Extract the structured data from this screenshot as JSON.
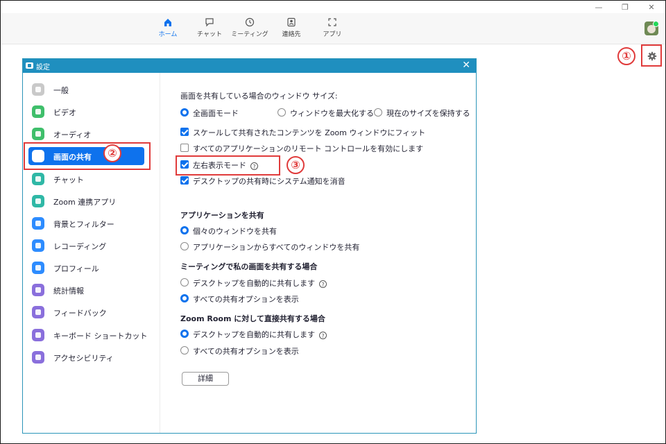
{
  "window_controls": {
    "minimize": "—",
    "restore": "❐",
    "close": "✕"
  },
  "top_nav": {
    "tabs": [
      {
        "label": "ホーム",
        "icon": "home-icon",
        "active": true
      },
      {
        "label": "チャット",
        "icon": "chat-icon",
        "active": false
      },
      {
        "label": "ミーティング",
        "icon": "clock-icon",
        "active": false
      },
      {
        "label": "連絡先",
        "icon": "contacts-icon",
        "active": false
      },
      {
        "label": "アプリ",
        "icon": "apps-icon",
        "active": false
      }
    ],
    "accent_color": "#0e72ed"
  },
  "callouts": {
    "one": "①",
    "two": "②",
    "three": "③"
  },
  "dialog": {
    "title": "設定",
    "close": "✕",
    "title_bar_color": "#1f8fbf"
  },
  "sidebar": {
    "items": [
      {
        "label": "一般",
        "icon": "gear-icon",
        "color": "#c9c9c9"
      },
      {
        "label": "ビデオ",
        "icon": "video-icon",
        "color": "#3fbf6b"
      },
      {
        "label": "オーディオ",
        "icon": "headphones-icon",
        "color": "#3fbf6b"
      },
      {
        "label": "画面の共有",
        "icon": "share-screen-icon",
        "color": "#ffffff",
        "selected": true
      },
      {
        "label": "チャット",
        "icon": "chat-icon",
        "color": "#2fb8a6"
      },
      {
        "label": "Zoom 連携アプリ",
        "icon": "apps-icon",
        "color": "#2fb8a6"
      },
      {
        "label": "背景とフィルター",
        "icon": "background-icon",
        "color": "#2d8cff"
      },
      {
        "label": "レコーディング",
        "icon": "record-icon",
        "color": "#2d8cff"
      },
      {
        "label": "プロフィール",
        "icon": "profile-icon",
        "color": "#2d8cff"
      },
      {
        "label": "統計情報",
        "icon": "statistics-icon",
        "color": "#8a6fdc"
      },
      {
        "label": "フィードバック",
        "icon": "feedback-icon",
        "color": "#8a6fdc"
      },
      {
        "label": "キーボード ショートカット",
        "icon": "keyboard-icon",
        "color": "#8a6fdc"
      },
      {
        "label": "アクセシビリティ",
        "icon": "accessibility-icon",
        "color": "#8a6fdc"
      }
    ]
  },
  "content": {
    "window_size_title": "画面を共有している場合のウィンドウ サイズ:",
    "window_size_options": [
      {
        "label": "全画面モード",
        "selected": true
      },
      {
        "label": "ウィンドウを最大化する",
        "selected": false
      },
      {
        "label": "現在のサイズを保持する",
        "selected": false
      }
    ],
    "checkboxes": [
      {
        "label": "スケールして共有されたコンテンツを Zoom ウィンドウにフィット",
        "checked": true
      },
      {
        "label": "すべてのアプリケーションのリモート コントロールを有効にします",
        "checked": false
      },
      {
        "label": "左右表示モード",
        "checked": true,
        "help": "?"
      },
      {
        "label": "デスクトップの共有時にシステム通知を消音",
        "checked": true
      }
    ],
    "app_share_title": "アプリケーションを共有",
    "app_share_options": [
      {
        "label": "個々のウィンドウを共有",
        "selected": true
      },
      {
        "label": "アプリケーションからすべてのウィンドウを共有",
        "selected": false
      }
    ],
    "meeting_share_title": "ミーティングで私の画面を共有する場合",
    "meeting_share_options": [
      {
        "label": "デスクトップを自動的に共有します",
        "selected": false,
        "help": "?"
      },
      {
        "label": "すべての共有オプションを表示",
        "selected": true
      }
    ],
    "zoom_room_title": "Zoom Room に対して直接共有する場合",
    "zoom_room_options": [
      {
        "label": "デスクトップを自動的に共有します",
        "selected": true,
        "help": "?"
      },
      {
        "label": "すべての共有オプションを表示",
        "selected": false
      }
    ],
    "detail_button": "詳細"
  }
}
